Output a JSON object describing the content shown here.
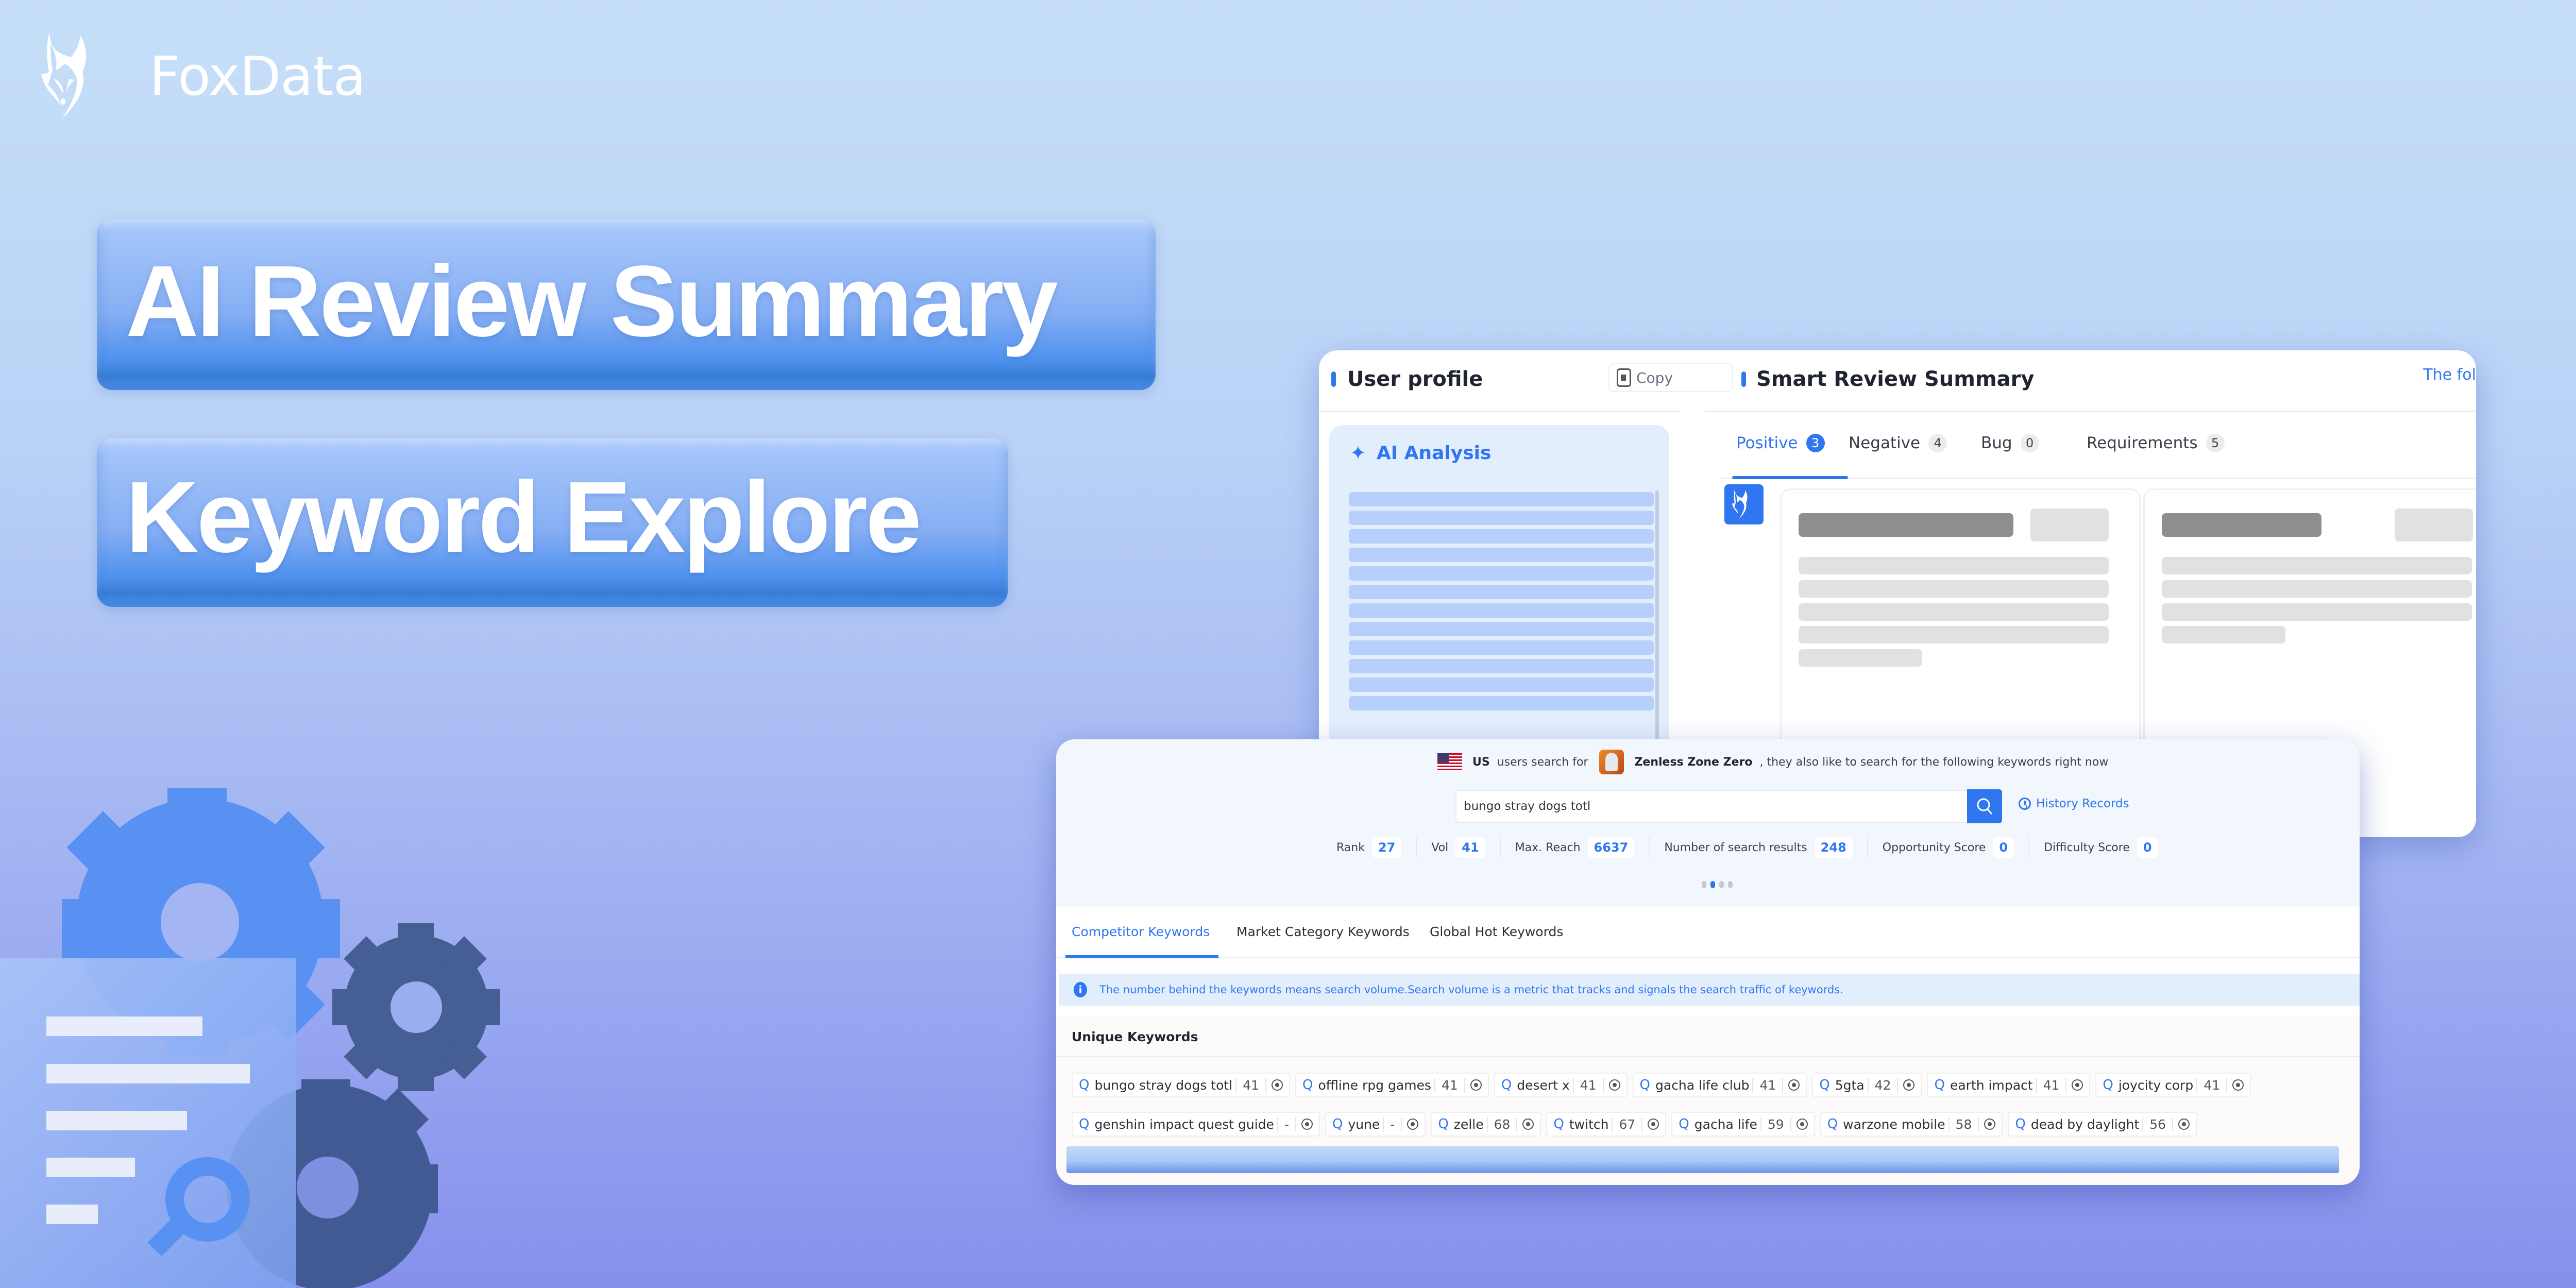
{
  "brand": {
    "name": "FoxData"
  },
  "headlines": [
    "AI Review Summary",
    "Keyword Explore"
  ],
  "review_panel": {
    "user_profile": {
      "title": "User profile",
      "copy_label": "Copy"
    },
    "ai_analysis": {
      "title": "AI Analysis",
      "skeleton_lines": 12
    },
    "smart_review": {
      "title": "Smart Review Summary",
      "truncated_link": "The fol",
      "tabs": [
        {
          "label": "Positive",
          "count": "3",
          "active": true
        },
        {
          "label": "Negative",
          "count": "4",
          "active": false
        },
        {
          "label": "Bug",
          "count": "0",
          "active": false
        },
        {
          "label": "Requirements",
          "count": "5",
          "active": false
        }
      ]
    }
  },
  "keyword_panel": {
    "intro": {
      "country": "US",
      "text_before_app": "users search for",
      "app_name": "Zenless Zone Zero",
      "text_after_app": ", they also like to search for the following keywords right now"
    },
    "search": {
      "value": "bungo stray dogs totl",
      "history_label": "History Records"
    },
    "metrics": [
      {
        "label": "Rank",
        "value": "27"
      },
      {
        "label": "Vol",
        "value": "41"
      },
      {
        "label": "Max. Reach",
        "value": "6637"
      },
      {
        "label": "Number of search results",
        "value": "248"
      },
      {
        "label": "Opportunity Score",
        "value": "0"
      },
      {
        "label": "Difficulty Score",
        "value": "0"
      }
    ],
    "carousel": {
      "pages": 4,
      "active_index": 1
    },
    "tabs": [
      {
        "label": "Competitor Keywords",
        "active": true
      },
      {
        "label": "Market Category Keywords",
        "active": false
      },
      {
        "label": "Global Hot Keywords",
        "active": false
      }
    ],
    "info": "The number behind the keywords means search volume.Search volume is a metric that tracks and signals the search traffic of keywords.",
    "unique_title": "Unique Keywords",
    "keyword_rows": [
      [
        {
          "kw": "bungo stray dogs totl",
          "vol": "41"
        },
        {
          "kw": "offline rpg games",
          "vol": "41"
        },
        {
          "kw": "desert x",
          "vol": "41"
        },
        {
          "kw": "gacha life club",
          "vol": "41"
        },
        {
          "kw": "5gta",
          "vol": "42"
        },
        {
          "kw": "earth impact",
          "vol": "41"
        },
        {
          "kw": "joycity corp",
          "vol": "41"
        }
      ],
      [
        {
          "kw": "genshin impact quest guide",
          "vol": "-"
        },
        {
          "kw": "yune",
          "vol": "-"
        },
        {
          "kw": "zelle",
          "vol": "68"
        },
        {
          "kw": "twitch",
          "vol": "67"
        },
        {
          "kw": "gacha life",
          "vol": "59"
        },
        {
          "kw": "warzone mobile",
          "vol": "58"
        },
        {
          "kw": "dead by daylight",
          "vol": "56"
        }
      ]
    ]
  },
  "colors": {
    "accent": "#2f76f0",
    "gear_blue": "#5891f2",
    "gear_dark": "#455f95"
  }
}
